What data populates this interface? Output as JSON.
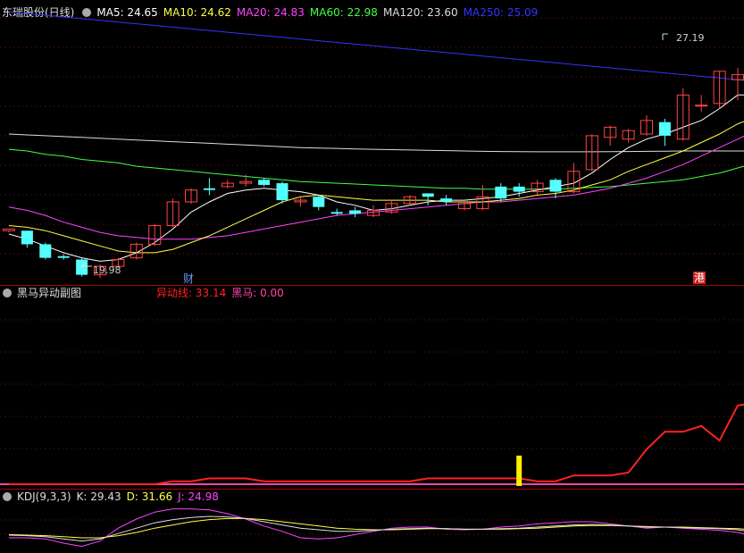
{
  "main": {
    "title": "东瑞股份(日线)",
    "ma": [
      {
        "label": "MA5: 24.65",
        "color": "#ffffff"
      },
      {
        "label": "MA10: 24.62",
        "color": "#ffff44"
      },
      {
        "label": "MA20: 24.83",
        "color": "#ff44ff"
      },
      {
        "label": "MA60: 22.98",
        "color": "#44ff44"
      },
      {
        "label": "MA120: 23.60",
        "color": "#dddddd"
      },
      {
        "label": "MA250: 25.09",
        "color": "#3333ff"
      }
    ],
    "high_label": "27.19",
    "low_label": "19.98",
    "event_cai": "财",
    "event_gang": "港",
    "candles": [
      [
        17.6,
        17.7,
        17.5,
        17.6
      ],
      [
        17.6,
        16.8,
        16.6,
        17.6
      ],
      [
        16.8,
        16.0,
        15.9,
        16.9
      ],
      [
        16.1,
        16.0,
        15.9,
        16.2
      ],
      [
        15.9,
        15.0,
        14.9,
        16.0
      ],
      [
        15.0,
        15.5,
        14.8,
        15.6
      ],
      [
        15.5,
        15.9,
        15.4,
        16.0
      ],
      [
        16.0,
        16.8,
        15.9,
        16.9
      ],
      [
        16.8,
        17.9,
        16.7,
        18.0
      ],
      [
        17.9,
        19.3,
        17.8,
        19.5
      ],
      [
        19.3,
        20.0,
        19.2,
        20.1
      ],
      [
        20.1,
        20.0,
        19.7,
        20.7
      ],
      [
        20.2,
        20.4,
        20.1,
        20.6
      ],
      [
        20.4,
        20.5,
        20.2,
        20.9
      ],
      [
        20.6,
        20.3,
        20.2,
        20.7
      ],
      [
        20.4,
        19.4,
        19.2,
        20.5
      ],
      [
        19.3,
        19.4,
        19.0,
        19.6
      ],
      [
        19.6,
        19.0,
        18.8,
        19.7
      ],
      [
        18.7,
        18.6,
        18.5,
        18.9
      ],
      [
        18.8,
        18.6,
        18.4,
        19.0
      ],
      [
        18.5,
        18.8,
        18.4,
        19.1
      ],
      [
        18.7,
        19.2,
        18.6,
        19.4
      ],
      [
        19.2,
        19.6,
        19.1,
        19.7
      ],
      [
        19.8,
        19.6,
        19.1,
        19.8
      ],
      [
        19.5,
        19.3,
        19.1,
        19.7
      ],
      [
        18.9,
        19.2,
        18.8,
        19.3
      ],
      [
        18.9,
        19.6,
        18.8,
        20.3
      ],
      [
        20.2,
        19.5,
        19.3,
        20.4
      ],
      [
        20.2,
        19.9,
        19.6,
        20.4
      ],
      [
        19.9,
        20.4,
        19.7,
        20.6
      ],
      [
        20.6,
        19.9,
        19.5,
        20.7
      ],
      [
        19.9,
        21.1,
        19.8,
        21.6
      ],
      [
        21.2,
        23.2,
        21.1,
        23.3
      ],
      [
        23.1,
        23.7,
        22.6,
        23.8
      ],
      [
        23.0,
        23.5,
        22.8,
        23.6
      ],
      [
        23.3,
        24.1,
        23.2,
        24.4
      ],
      [
        24.0,
        23.2,
        22.6,
        24.2
      ],
      [
        23.0,
        25.6,
        22.9,
        26.0
      ],
      [
        25.0,
        25.0,
        24.6,
        25.6
      ],
      [
        25.1,
        27.0,
        24.8,
        27.0
      ],
      [
        26.5,
        26.8,
        25.3,
        27.2
      ],
      [
        26.9,
        25.1,
        24.9,
        27.1
      ],
      [
        24.8,
        25.0,
        24.5,
        25.2
      ],
      [
        25.0,
        24.6,
        24.3,
        25.3
      ]
    ],
    "ma5": [
      17.4,
      17.1,
      16.7,
      16.3,
      16.0,
      15.8,
      15.9,
      16.3,
      16.9,
      17.7,
      18.7,
      19.3,
      19.8,
      20.0,
      20.1,
      20.0,
      19.9,
      19.7,
      19.3,
      19.1,
      18.8,
      18.9,
      19.1,
      19.3,
      19.4,
      19.4,
      19.5,
      19.6,
      19.8,
      20.0,
      20.2,
      20.4,
      21.0,
      21.8,
      22.5,
      23.0,
      23.3,
      23.7,
      24.1,
      24.8,
      25.6,
      25.6,
      25.3,
      24.65
    ],
    "ma10": [
      17.9,
      17.8,
      17.6,
      17.3,
      17.0,
      16.7,
      16.4,
      16.3,
      16.3,
      16.5,
      16.9,
      17.3,
      17.8,
      18.3,
      18.8,
      19.3,
      19.6,
      19.7,
      19.6,
      19.5,
      19.4,
      19.4,
      19.4,
      19.4,
      19.3,
      19.3,
      19.3,
      19.4,
      19.5,
      19.7,
      19.8,
      20.0,
      20.3,
      20.6,
      21.1,
      21.5,
      21.9,
      22.3,
      22.8,
      23.3,
      23.9,
      24.3,
      24.6,
      24.62
    ],
    "ma20": [
      19.0,
      18.8,
      18.5,
      18.1,
      17.8,
      17.5,
      17.3,
      17.2,
      17.1,
      17.1,
      17.1,
      17.2,
      17.3,
      17.5,
      17.7,
      17.9,
      18.1,
      18.3,
      18.5,
      18.6,
      18.7,
      18.8,
      18.9,
      19.0,
      19.1,
      19.2,
      19.3,
      19.3,
      19.4,
      19.5,
      19.6,
      19.7,
      19.9,
      20.1,
      20.4,
      20.7,
      21.1,
      21.5,
      22.0,
      22.5,
      23.0,
      23.5,
      24.0,
      24.83
    ],
    "ma60": [
      22.4,
      22.3,
      22.1,
      22.0,
      21.8,
      21.7,
      21.6,
      21.4,
      21.3,
      21.2,
      21.1,
      21.0,
      20.9,
      20.8,
      20.7,
      20.6,
      20.5,
      20.45,
      20.4,
      20.35,
      20.3,
      20.25,
      20.2,
      20.15,
      20.1,
      20.1,
      20.05,
      20.05,
      20.05,
      20.05,
      20.05,
      20.1,
      20.15,
      20.2,
      20.3,
      20.4,
      20.5,
      20.6,
      20.8,
      21.0,
      21.3,
      21.6,
      22.0,
      22.98
    ],
    "ma120": [
      23.3,
      23.25,
      23.2,
      23.15,
      23.1,
      23.05,
      23.0,
      22.95,
      22.9,
      22.85,
      22.8,
      22.75,
      22.7,
      22.65,
      22.6,
      22.55,
      22.5,
      22.47,
      22.45,
      22.42,
      22.4,
      22.38,
      22.36,
      22.34,
      22.32,
      22.3,
      22.28,
      22.27,
      22.26,
      22.25,
      22.25,
      22.25,
      22.25,
      22.26,
      22.27,
      22.28,
      22.29,
      22.3,
      22.3,
      22.3,
      22.3,
      22.3,
      22.3,
      22.3
    ],
    "ma250": [
      30.5,
      30.4,
      30.3,
      30.2,
      30.1,
      30.0,
      29.9,
      29.8,
      29.7,
      29.6,
      29.5,
      29.4,
      29.3,
      29.2,
      29.1,
      29.0,
      28.9,
      28.8,
      28.7,
      28.6,
      28.5,
      28.4,
      28.3,
      28.2,
      28.1,
      28.0,
      27.9,
      27.8,
      27.7,
      27.6,
      27.5,
      27.4,
      27.3,
      27.2,
      27.1,
      27.0,
      26.9,
      26.8,
      26.7,
      26.6,
      26.5,
      26.4,
      26.3,
      26.2
    ]
  },
  "sub1": {
    "title": "黑马异动副图",
    "yd_label": "异动线: 33.14",
    "hm_label": "黑马: 0.00",
    "yd_color": "#ff2222",
    "hm_color": "#ff44aa",
    "yd_values": [
      0,
      0,
      0,
      0,
      0,
      0,
      0,
      0,
      0,
      1,
      1,
      2,
      2,
      2,
      1,
      1,
      1,
      1,
      1,
      1,
      1,
      1,
      1,
      2,
      2,
      2,
      2,
      2,
      2,
      1,
      1,
      3,
      3,
      3,
      4,
      12,
      18,
      18,
      20,
      15,
      27,
      28,
      50,
      62
    ],
    "signal_index": 28,
    "ymax": 65
  },
  "kdj": {
    "title": "KDJ(9,3,3)",
    "k_label": "K: 29.43",
    "d_label": "D: 31.66",
    "j_label": "J: 24.98",
    "k": [
      45,
      44,
      42,
      38,
      34,
      38,
      48,
      58,
      68,
      74,
      78,
      80,
      79,
      76,
      70,
      64,
      58,
      55,
      52,
      52,
      54,
      56,
      57,
      58,
      57,
      56,
      56,
      57,
      58,
      60,
      62,
      64,
      65,
      64,
      62,
      60,
      60,
      59,
      58,
      57,
      55,
      50,
      45,
      40
    ],
    "d": [
      46,
      45,
      44,
      42,
      40,
      40,
      44,
      50,
      58,
      64,
      70,
      74,
      76,
      76,
      74,
      70,
      66,
      62,
      58,
      56,
      55,
      55,
      56,
      57,
      57,
      56,
      56,
      56,
      57,
      58,
      60,
      62,
      63,
      63,
      62,
      61,
      60,
      60,
      59,
      58,
      57,
      55,
      50,
      46
    ],
    "j": [
      40,
      40,
      38,
      30,
      24,
      34,
      58,
      75,
      88,
      94,
      94,
      92,
      85,
      75,
      62,
      52,
      40,
      38,
      40,
      46,
      52,
      58,
      60,
      60,
      56,
      55,
      56,
      60,
      62,
      66,
      68,
      70,
      70,
      66,
      62,
      58,
      60,
      58,
      56,
      54,
      50,
      42,
      32,
      26
    ]
  }
}
